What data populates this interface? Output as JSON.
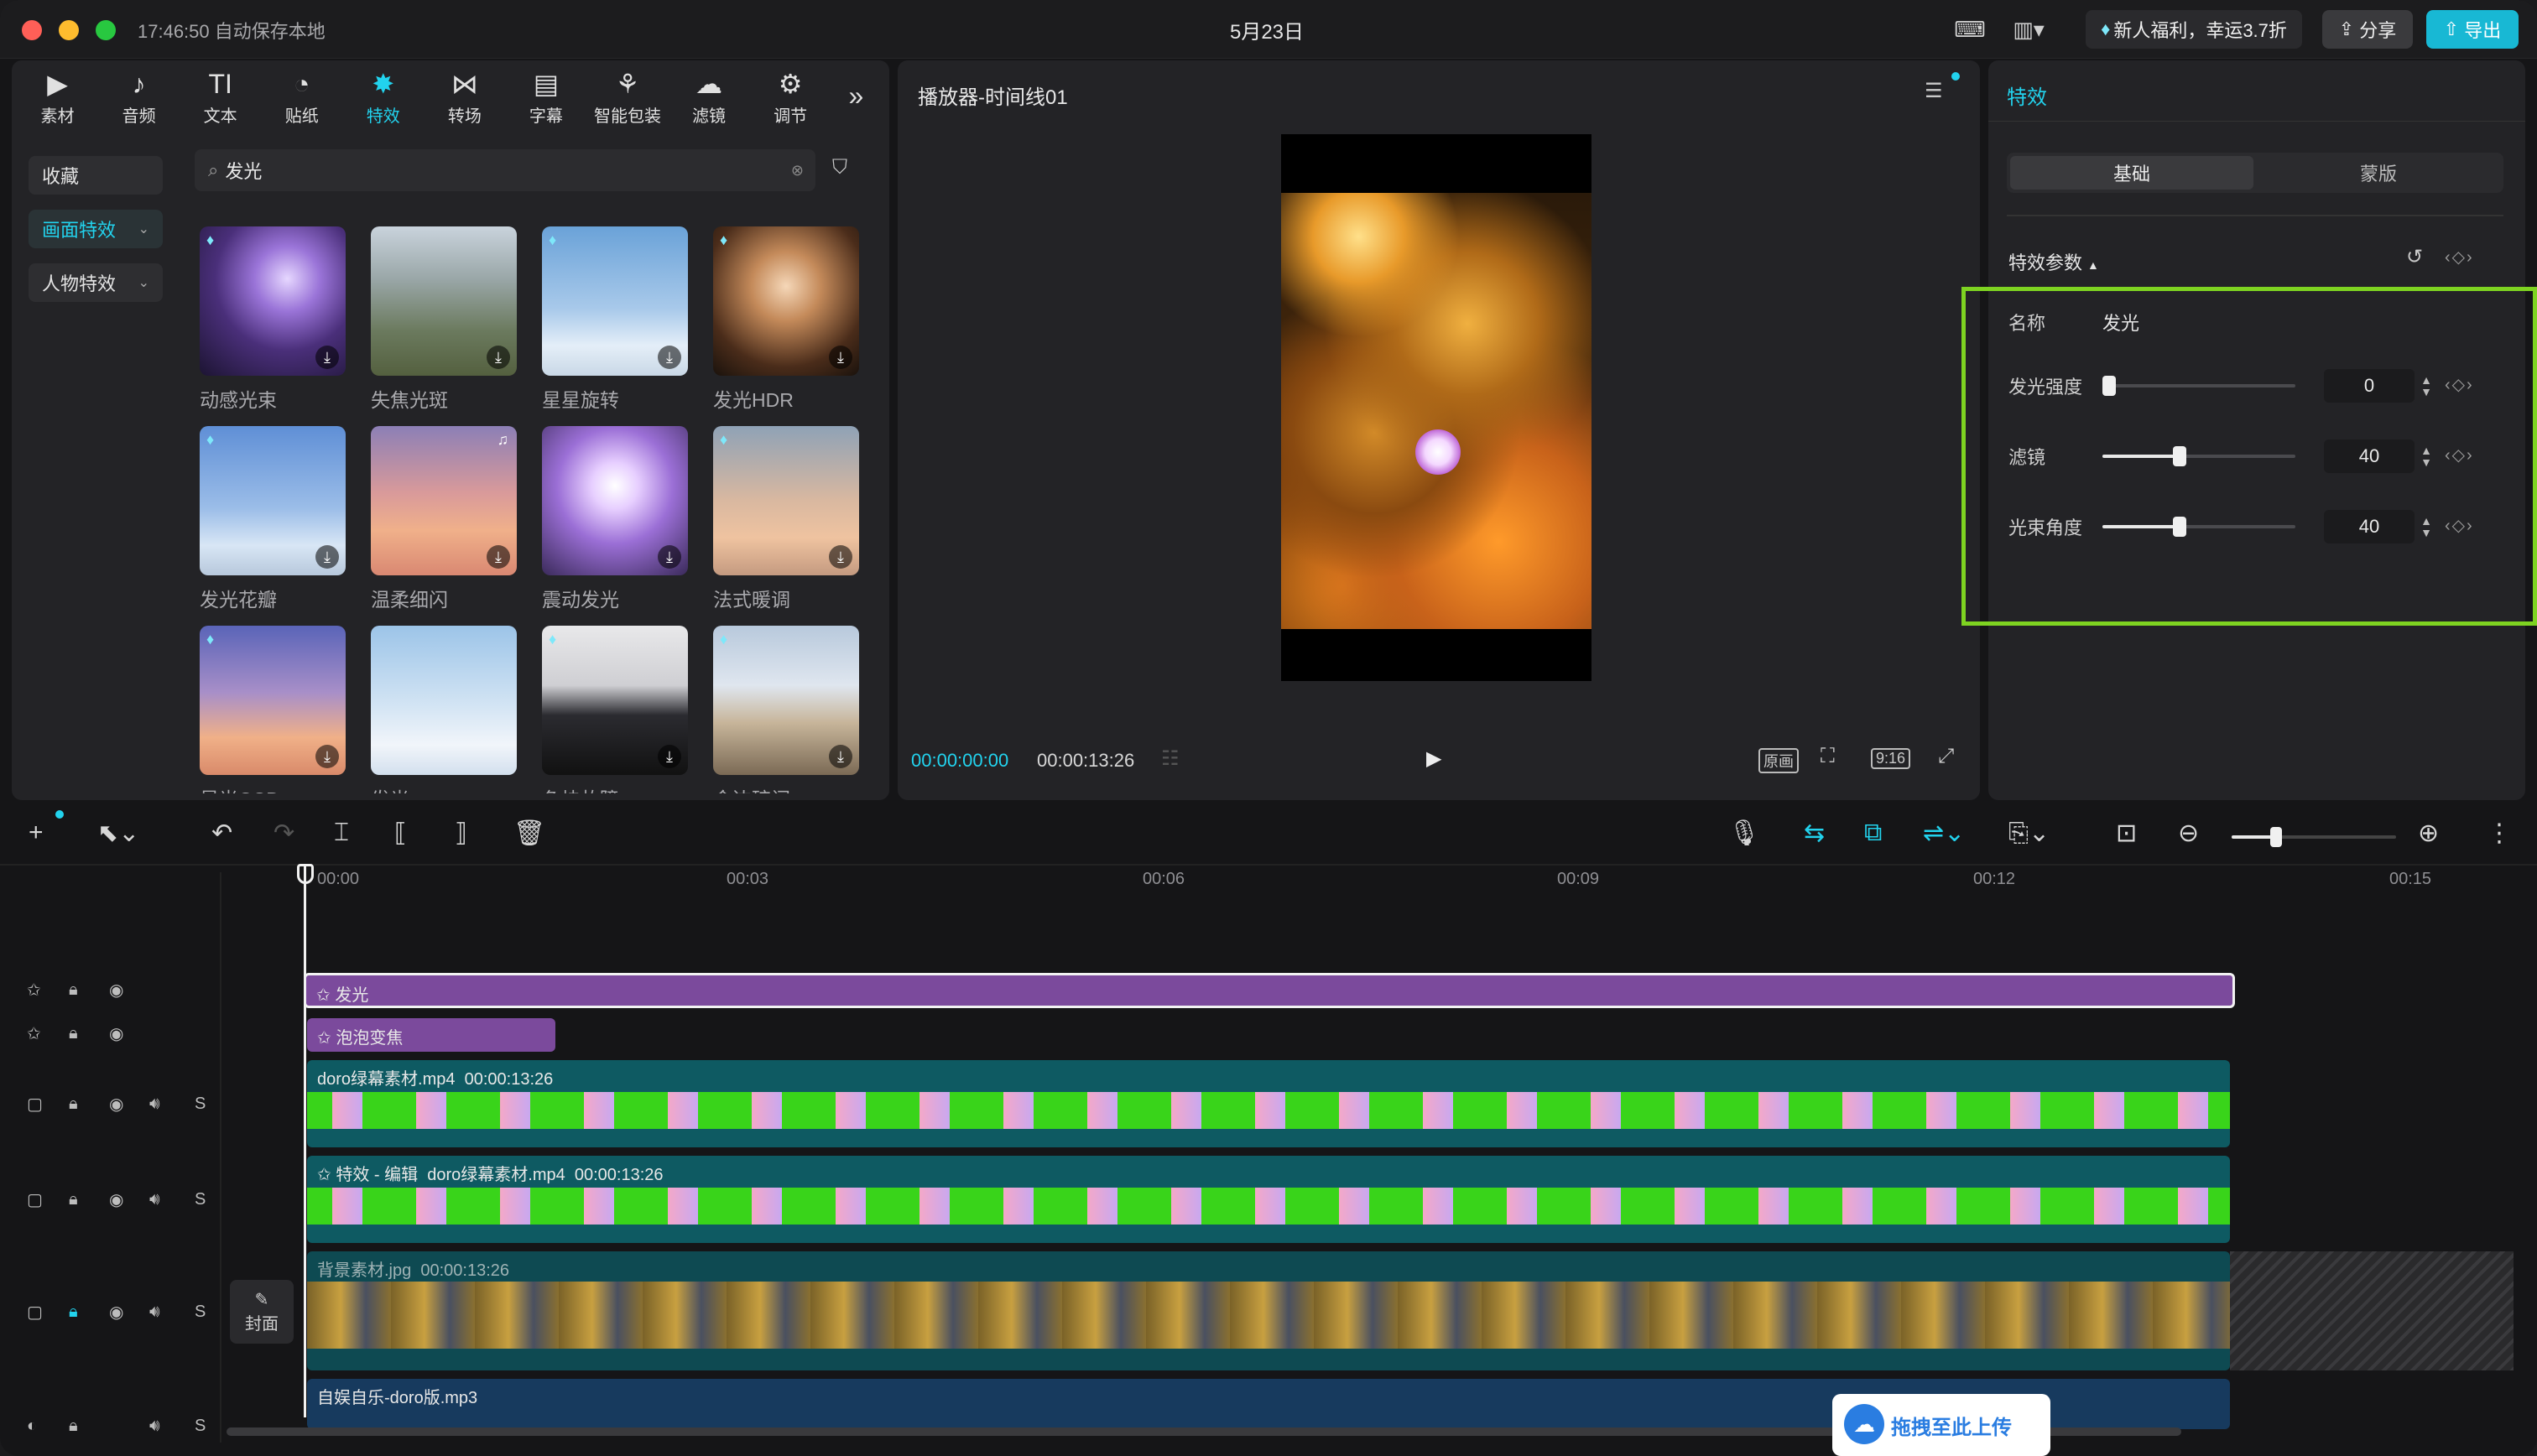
{
  "titlebar": {
    "status": "17:46:50 自动保存本地",
    "date": "5月23日",
    "promo": "新人福利，幸运3.7折",
    "share_label": "分享",
    "export_label": "导出"
  },
  "toolbar": {
    "tabs": [
      {
        "label": "素材",
        "icon": "media-icon"
      },
      {
        "label": "音频",
        "icon": "audio-icon"
      },
      {
        "label": "文本",
        "icon": "text-icon"
      },
      {
        "label": "贴纸",
        "icon": "sticker-icon"
      },
      {
        "label": "特效",
        "icon": "effects-icon",
        "active": true
      },
      {
        "label": "转场",
        "icon": "transition-icon"
      },
      {
        "label": "字幕",
        "icon": "caption-icon"
      },
      {
        "label": "智能包装",
        "icon": "smart-pack-icon"
      },
      {
        "label": "滤镜",
        "icon": "filter-icon"
      },
      {
        "label": "调节",
        "icon": "adjust-icon"
      }
    ]
  },
  "sidebar": {
    "items": [
      {
        "label": "收藏"
      },
      {
        "label": "画面特效"
      },
      {
        "label": "人物特效"
      }
    ]
  },
  "search": {
    "value": "发光"
  },
  "effects": [
    {
      "label": "动感光束"
    },
    {
      "label": "失焦光斑"
    },
    {
      "label": "星星旋转"
    },
    {
      "label": "发光HDR"
    },
    {
      "label": "发光花瓣"
    },
    {
      "label": "温柔细闪"
    },
    {
      "label": "震动发光"
    },
    {
      "label": "法式暖调"
    },
    {
      "label": "星光CCD"
    },
    {
      "label": "发光"
    },
    {
      "label": "色块故障"
    },
    {
      "label": "金边碎闪"
    }
  ],
  "player": {
    "title": "播放器-时间线01",
    "current_time": "00:00:00:00",
    "total_time": "00:00:13:26",
    "original_label": "原画",
    "ratio_label": "9:16"
  },
  "inspector": {
    "title": "特效",
    "tab_basic": "基础",
    "tab_mask": "蒙版",
    "section_title": "特效参数",
    "name_label": "名称",
    "name_value": "发光",
    "params": [
      {
        "label": "发光强度",
        "value": "0",
        "level": 0.0
      },
      {
        "label": "滤镜",
        "value": "40",
        "level": 0.4
      },
      {
        "label": "光束角度",
        "value": "40",
        "level": 0.4
      }
    ]
  },
  "timeline": {
    "ruler": [
      "00:00",
      "00:03",
      "00:06",
      "00:09",
      "00:12",
      "00:15"
    ],
    "cover_label": "封面",
    "track_s": "S",
    "clips": {
      "effect1": "发光",
      "effect2": "泡泡变焦",
      "video1_name": "doro绿幕素材.mp4",
      "video1_dur": "00:00:13:26",
      "video2_prefix": "特效 - 编辑",
      "video2_name": "doro绿幕素材.mp4",
      "video2_dur": "00:00:13:26",
      "bg_name": "背景素材.jpg",
      "bg_dur": "00:00:13:26",
      "audio_name": "自娱自乐-doro版.mp3"
    },
    "upload_label": "拖拽至此上传"
  },
  "colors": {
    "accent": "#22d3ee",
    "effect_clip": "#7b4a9c",
    "green_screen": "#39d41a",
    "video_header": "#0e5a62",
    "highlight": "#7ed321"
  }
}
